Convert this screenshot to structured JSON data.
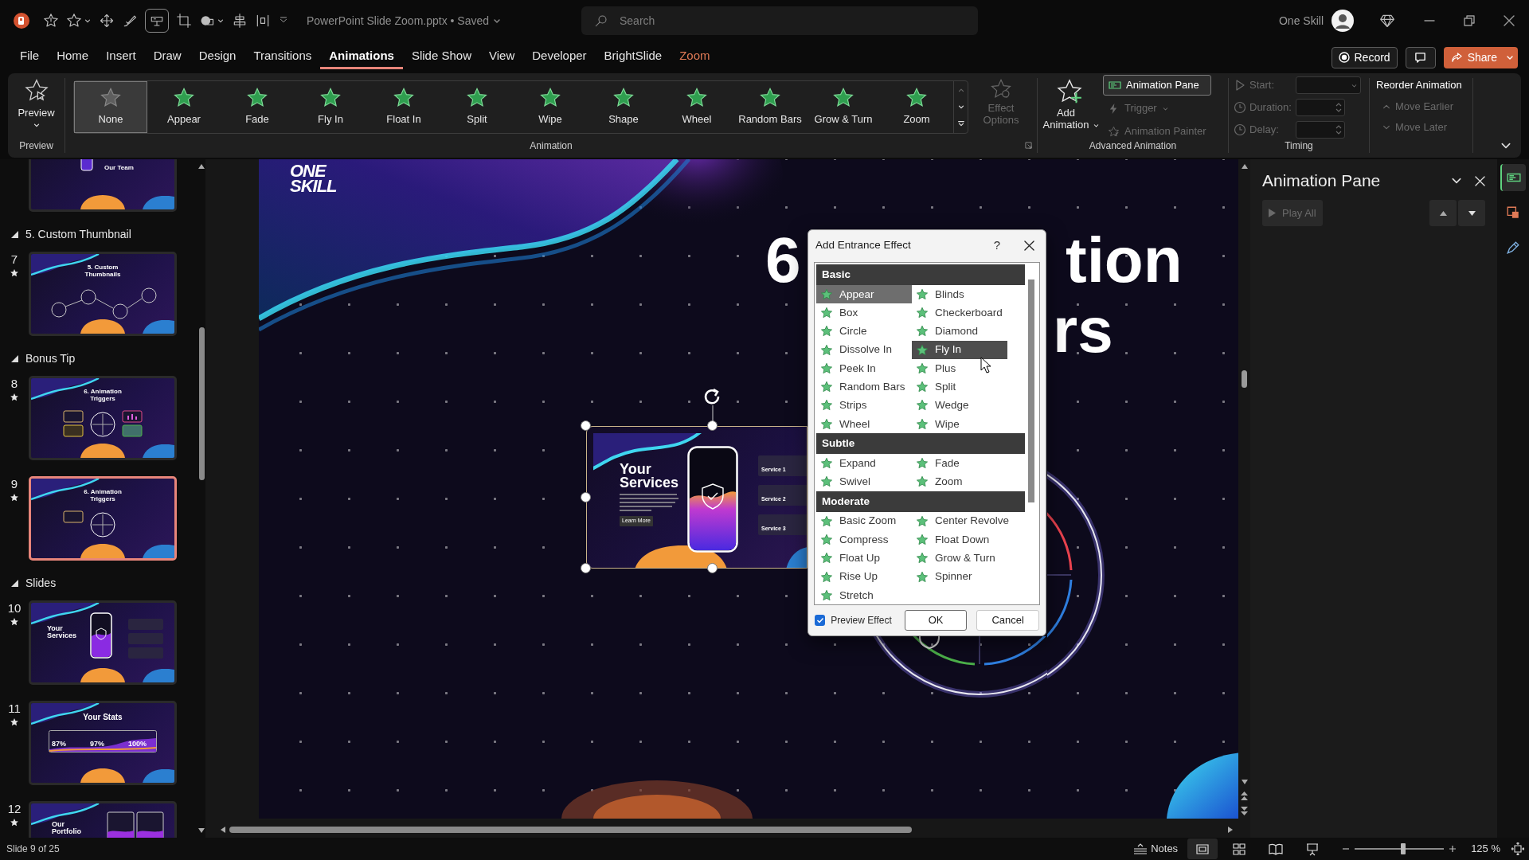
{
  "title_bar": {
    "document_title": "PowerPoint Slide Zoom.pptx • Saved",
    "search_placeholder": "Search",
    "account_name": "One Skill"
  },
  "menu_tabs": [
    {
      "label": "File",
      "selected": false,
      "contextual": false
    },
    {
      "label": "Home",
      "selected": false,
      "contextual": false
    },
    {
      "label": "Insert",
      "selected": false,
      "contextual": false
    },
    {
      "label": "Draw",
      "selected": false,
      "contextual": false
    },
    {
      "label": "Design",
      "selected": false,
      "contextual": false
    },
    {
      "label": "Transitions",
      "selected": false,
      "contextual": false
    },
    {
      "label": "Animations",
      "selected": true,
      "contextual": false
    },
    {
      "label": "Slide Show",
      "selected": false,
      "contextual": false
    },
    {
      "label": "View",
      "selected": false,
      "contextual": false
    },
    {
      "label": "Developer",
      "selected": false,
      "contextual": false
    },
    {
      "label": "BrightSlide",
      "selected": false,
      "contextual": false
    },
    {
      "label": "Zoom",
      "selected": false,
      "contextual": true
    }
  ],
  "record_button": "Record",
  "share_button": "Share",
  "ribbon": {
    "preview": {
      "label": "Preview",
      "group_label": "Preview"
    },
    "animation_gallery": [
      {
        "label": "None",
        "selected": true,
        "kind": "none"
      },
      {
        "label": "Appear",
        "selected": false,
        "kind": "effect"
      },
      {
        "label": "Fade",
        "selected": false,
        "kind": "effect"
      },
      {
        "label": "Fly In",
        "selected": false,
        "kind": "effect"
      },
      {
        "label": "Float In",
        "selected": false,
        "kind": "effect"
      },
      {
        "label": "Split",
        "selected": false,
        "kind": "effect"
      },
      {
        "label": "Wipe",
        "selected": false,
        "kind": "effect"
      },
      {
        "label": "Shape",
        "selected": false,
        "kind": "effect"
      },
      {
        "label": "Wheel",
        "selected": false,
        "kind": "effect"
      },
      {
        "label": "Random Bars",
        "selected": false,
        "kind": "effect"
      },
      {
        "label": "Grow & Turn",
        "selected": false,
        "kind": "effect"
      },
      {
        "label": "Zoom",
        "selected": false,
        "kind": "effect"
      }
    ],
    "effect_options": {
      "label": "Effect Options",
      "disabled": true
    },
    "animation_group_label": "Animation",
    "add_animation": "Add Animation",
    "animation_pane_button": {
      "label": "Animation Pane",
      "selected": true
    },
    "trigger": {
      "label": "Trigger",
      "disabled": true
    },
    "animation_painter": {
      "label": "Animation Painter",
      "disabled": true
    },
    "advanced_group_label": "Advanced Animation",
    "timing_fields": [
      {
        "label": "Start:",
        "kind": "dropdown",
        "disabled": true
      },
      {
        "label": "Duration:",
        "kind": "spinner",
        "disabled": true
      },
      {
        "label": "Delay:",
        "kind": "spinner",
        "disabled": true
      }
    ],
    "timing_group_label": "Timing",
    "reorder": {
      "title": "Reorder Animation",
      "items": [
        {
          "label": "Move Earlier",
          "kind": "up",
          "disabled": true
        },
        {
          "label": "Move Later",
          "kind": "down",
          "disabled": true
        }
      ]
    }
  },
  "slides_panel": [
    {
      "kind": "team",
      "title": "Our Team",
      "selected": false
    },
    {
      "kind": "section",
      "label": "5. Custom Thumbnail",
      "expanded": true
    },
    {
      "kind": "thumbnails",
      "number": "7",
      "title": "5. Custom Thumbnails",
      "selected": false
    },
    {
      "kind": "section",
      "label": "Bonus Tip",
      "expanded": true
    },
    {
      "kind": "triggers-all",
      "number": "8",
      "title": "6. Animation Triggers",
      "selected": false
    },
    {
      "kind": "triggers-one",
      "number": "9",
      "title": "6. Animation Triggers",
      "selected": true
    },
    {
      "kind": "section",
      "label": "Slides",
      "expanded": true
    },
    {
      "kind": "services",
      "number": "10",
      "title": "Your Services",
      "selected": false
    },
    {
      "kind": "stats",
      "number": "11",
      "title": "Your Stats",
      "values": [
        "87%",
        "97%",
        "100%"
      ],
      "selected": false
    },
    {
      "kind": "portfolio",
      "number": "12",
      "title": "Our Portfolio",
      "selected": false
    }
  ],
  "slide": {
    "logo": [
      "ONE",
      "SKILL"
    ],
    "title_parts": [
      "6",
      "tion",
      "rs"
    ],
    "zoom_object": {
      "selected": true,
      "title": "Your Services",
      "button": "Learn More",
      "services": [
        "Service 1",
        "Service 2",
        "Service 3"
      ]
    }
  },
  "animation_pane": {
    "title": "Animation Pane",
    "play_all": {
      "label": "Play All",
      "disabled": true
    }
  },
  "side_strip": [
    {
      "kind": "animation-pane",
      "selected": true
    },
    {
      "kind": "designer",
      "selected": false
    },
    {
      "kind": "draw",
      "selected": false
    }
  ],
  "dialog": {
    "title": "Add Entrance Effect",
    "help": "?",
    "categories": [
      {
        "label": "Basic",
        "effects": [
          {
            "label": "Appear",
            "selected": true,
            "hovered": false
          },
          {
            "label": "Blinds",
            "selected": false,
            "hovered": false
          },
          {
            "label": "Box",
            "selected": false,
            "hovered": false
          },
          {
            "label": "Checkerboard",
            "selected": false,
            "hovered": false
          },
          {
            "label": "Circle",
            "selected": false,
            "hovered": false
          },
          {
            "label": "Diamond",
            "selected": false,
            "hovered": false
          },
          {
            "label": "Dissolve In",
            "selected": false,
            "hovered": false
          },
          {
            "label": "Fly In",
            "selected": false,
            "hovered": true
          },
          {
            "label": "Peek In",
            "selected": false,
            "hovered": false
          },
          {
            "label": "Plus",
            "selected": false,
            "hovered": false
          },
          {
            "label": "Random Bars",
            "selected": false,
            "hovered": false
          },
          {
            "label": "Split",
            "selected": false,
            "hovered": false
          },
          {
            "label": "Strips",
            "selected": false,
            "hovered": false
          },
          {
            "label": "Wedge",
            "selected": false,
            "hovered": false
          },
          {
            "label": "Wheel",
            "selected": false,
            "hovered": false
          },
          {
            "label": "Wipe",
            "selected": false,
            "hovered": false
          }
        ]
      },
      {
        "label": "Subtle",
        "effects": [
          {
            "label": "Expand",
            "selected": false,
            "hovered": false
          },
          {
            "label": "Fade",
            "selected": false,
            "hovered": false
          },
          {
            "label": "Swivel",
            "selected": false,
            "hovered": false
          },
          {
            "label": "Zoom",
            "selected": false,
            "hovered": false
          }
        ]
      },
      {
        "label": "Moderate",
        "effects": [
          {
            "label": "Basic Zoom",
            "selected": false,
            "hovered": false
          },
          {
            "label": "Center Revolve",
            "selected": false,
            "hovered": false
          },
          {
            "label": "Compress",
            "selected": false,
            "hovered": false
          },
          {
            "label": "Float Down",
            "selected": false,
            "hovered": false
          },
          {
            "label": "Float Up",
            "selected": false,
            "hovered": false
          },
          {
            "label": "Grow & Turn",
            "selected": false,
            "hovered": false
          },
          {
            "label": "Rise Up",
            "selected": false,
            "hovered": false
          },
          {
            "label": "Spinner",
            "selected": false,
            "hovered": false
          },
          {
            "label": "Stretch",
            "selected": false,
            "hovered": false
          }
        ]
      }
    ],
    "preview_effect": {
      "label": "Preview Effect",
      "checked": true
    },
    "buttons": [
      "OK",
      "Cancel"
    ]
  },
  "status_bar": {
    "slide_position": "Slide 9 of 25",
    "notes": "Notes",
    "views": [
      {
        "kind": "normal",
        "selected": true
      },
      {
        "kind": "sorter",
        "selected": false
      },
      {
        "kind": "reading",
        "selected": false
      },
      {
        "kind": "slideshow",
        "selected": false
      }
    ],
    "zoom_slider": {
      "level": 0.54
    },
    "zoom_percent": "125 %"
  }
}
